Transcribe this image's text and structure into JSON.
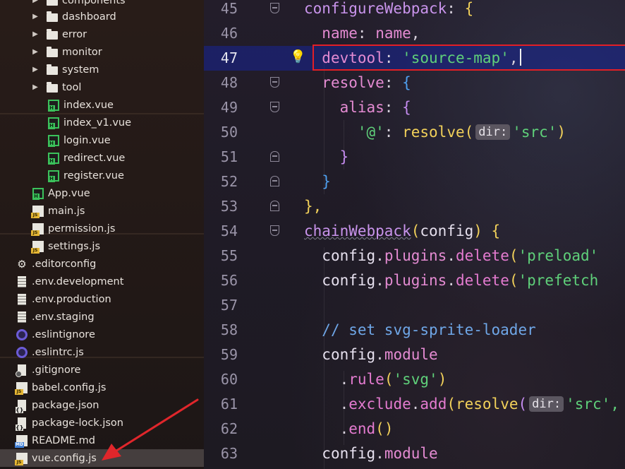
{
  "tree": {
    "items": [
      {
        "label": "components",
        "icon": "folder-icon",
        "expandable": true
      },
      {
        "label": "dashboard",
        "icon": "folder-icon",
        "expandable": true
      },
      {
        "label": "error",
        "icon": "folder-icon",
        "expandable": true
      },
      {
        "label": "monitor",
        "icon": "folder-icon",
        "expandable": true
      },
      {
        "label": "system",
        "icon": "folder-icon",
        "expandable": true
      },
      {
        "label": "tool",
        "icon": "folder-icon",
        "expandable": true
      },
      {
        "label": "index.vue",
        "icon": "vue-file-icon"
      },
      {
        "label": "index_v1.vue",
        "icon": "vue-file-icon"
      },
      {
        "label": "login.vue",
        "icon": "vue-file-icon"
      },
      {
        "label": "redirect.vue",
        "icon": "vue-file-icon"
      },
      {
        "label": "register.vue",
        "icon": "vue-file-icon"
      },
      {
        "label": "App.vue",
        "icon": "vue-file-icon"
      },
      {
        "label": "main.js",
        "icon": "js-file-icon"
      },
      {
        "label": "permission.js",
        "icon": "js-file-icon"
      },
      {
        "label": "settings.js",
        "icon": "js-file-icon"
      },
      {
        "label": ".editorconfig",
        "icon": "gear-icon"
      },
      {
        "label": ".env.development",
        "icon": "text-file-icon"
      },
      {
        "label": ".env.production",
        "icon": "text-file-icon"
      },
      {
        "label": ".env.staging",
        "icon": "text-file-icon"
      },
      {
        "label": ".eslintignore",
        "icon": "eslint-icon"
      },
      {
        "label": ".eslintrc.js",
        "icon": "eslint-icon"
      },
      {
        "label": ".gitignore",
        "icon": "git-file-icon"
      },
      {
        "label": "babel.config.js",
        "icon": "js-file-icon"
      },
      {
        "label": "package.json",
        "icon": "json-file-icon"
      },
      {
        "label": "package-lock.json",
        "icon": "json-file-icon"
      },
      {
        "label": "README.md",
        "icon": "markdown-file-icon"
      },
      {
        "label": "vue.config.js",
        "icon": "js-file-icon",
        "selected": true
      }
    ]
  },
  "editor": {
    "current_line": "47",
    "lines": [
      {
        "num": "45"
      },
      {
        "num": "46"
      },
      {
        "num": "47"
      },
      {
        "num": "48"
      },
      {
        "num": "49"
      },
      {
        "num": "50"
      },
      {
        "num": "51"
      },
      {
        "num": "52"
      },
      {
        "num": "53"
      },
      {
        "num": "54"
      },
      {
        "num": "55"
      },
      {
        "num": "56"
      },
      {
        "num": "57"
      },
      {
        "num": "58"
      },
      {
        "num": "59"
      },
      {
        "num": "60"
      },
      {
        "num": "61"
      },
      {
        "num": "62"
      },
      {
        "num": "63"
      }
    ],
    "tokens": {
      "l45_fn": "configureWebpack",
      "l45_colon": ":",
      "l45_brace": "{",
      "l46_key": "name",
      "l46_colon": ":",
      "l46_val": "name",
      "l46_comma": ",",
      "l47_key": "devtool",
      "l47_colon": ":",
      "l47_val": "'source-map'",
      "l47_comma": ",",
      "l48_key": "resolve",
      "l48_colon": ":",
      "l48_brace": "{",
      "l49_key": "alias",
      "l49_colon": ":",
      "l49_brace": "{",
      "l50_key": "'@'",
      "l50_colon": ":",
      "l50_fn": "resolve",
      "l50_open": "(",
      "l50_hint": "dir:",
      "l50_arg": "'src'",
      "l50_close": ")",
      "l51_brace": "}",
      "l52_brace": "}",
      "l53_brace": "},",
      "l54_fn": "chainWebpack",
      "l54_open": "(",
      "l54_param": "config",
      "l54_close": ")",
      "l54_brace": "{",
      "l55_obj": "config",
      "l55_dot1": ".",
      "l55_prop": "plugins",
      "l55_dot2": ".",
      "l55_meth": "delete",
      "l55_open": "(",
      "l55_arg": "'preload'",
      "l56_obj": "config",
      "l56_dot1": ".",
      "l56_prop": "plugins",
      "l56_dot2": ".",
      "l56_meth": "delete",
      "l56_open": "(",
      "l56_arg": "'prefetch",
      "l58_comment": "// set svg-sprite-loader",
      "l59_obj": "config",
      "l59_dot": ".",
      "l59_prop": "module",
      "l60_dot": ".",
      "l60_meth": "rule",
      "l60_open": "(",
      "l60_arg": "'svg'",
      "l60_close": ")",
      "l61_dot1": ".",
      "l61_meth": "exclude",
      "l61_dot2": ".",
      "l61_meth2": "add",
      "l61_open": "(",
      "l61_fn": "resolve",
      "l61_open2": "(",
      "l61_hint": "dir:",
      "l61_arg": "'src',",
      "l62_dot": ".",
      "l62_meth": "end",
      "l62_paren": "()",
      "l63_obj": "config",
      "l63_dot": ".",
      "l63_prop": "module"
    }
  },
  "colors": {
    "current_line_bg": "#18249a",
    "annotation_red": "#e21f26",
    "string_green": "#5fd07a",
    "property_pink": "#e48bd2"
  }
}
